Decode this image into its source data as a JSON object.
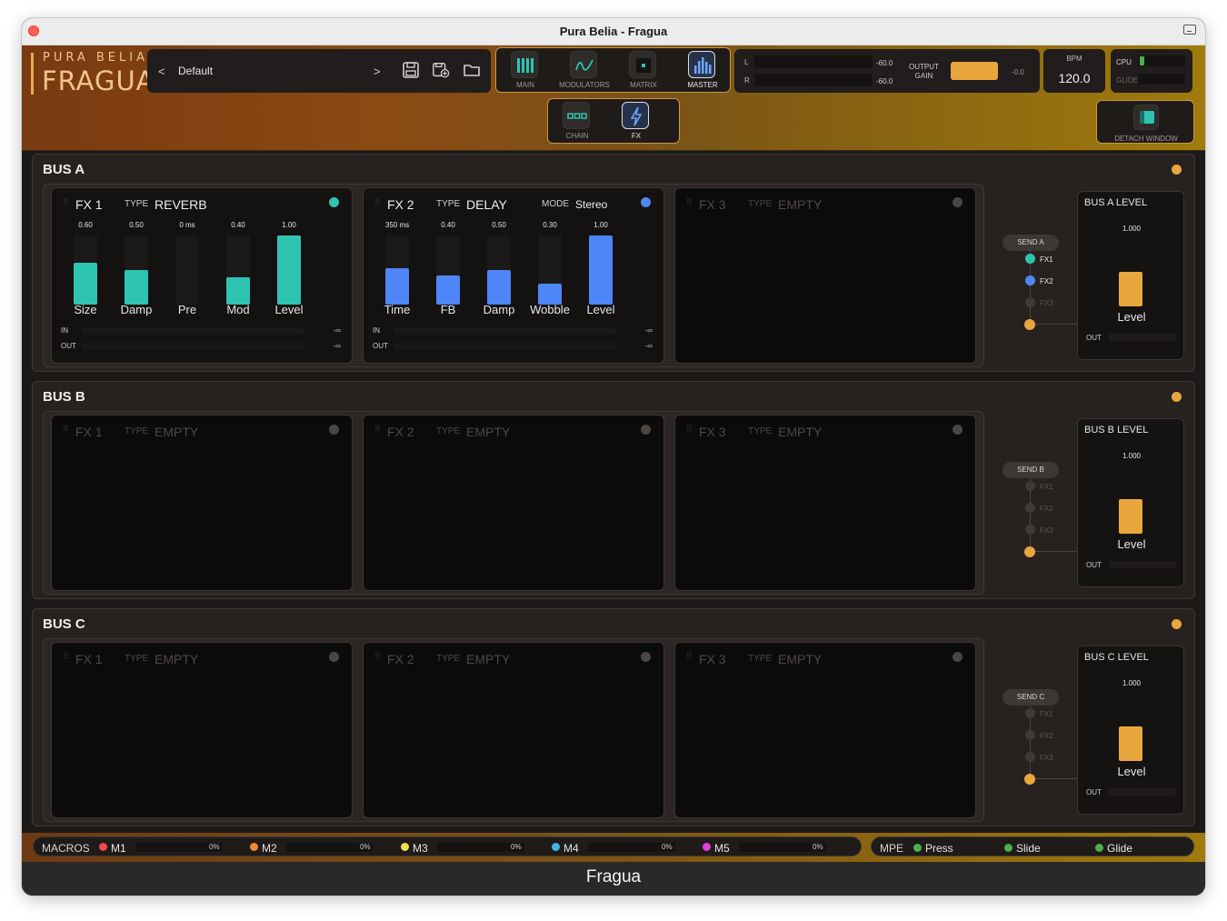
{
  "window": {
    "title": "Pura Belia - Fragua"
  },
  "brand": {
    "top": "PURA BELIA",
    "main": "FRAGUA"
  },
  "preset": {
    "prev": "<",
    "name": "Default",
    "next": ">"
  },
  "tabs": {
    "top": [
      {
        "label": "MAIN",
        "icon": "bars-icon"
      },
      {
        "label": "MODULATORS",
        "icon": "wave-icon"
      },
      {
        "label": "MATRIX",
        "icon": "matrix-icon"
      },
      {
        "label": "MASTER",
        "icon": "equalizer-icon",
        "active": true
      }
    ],
    "sub": [
      {
        "label": "CHAIN",
        "icon": "chain-icon"
      },
      {
        "label": "FX",
        "icon": "bolt-icon",
        "active": true
      }
    ]
  },
  "meters": {
    "l_label": "L",
    "r_label": "R",
    "l_value": "-60.0",
    "r_value": "-60.0",
    "gain_label_1": "OUTPUT",
    "gain_label_2": "GAIN",
    "gain_value": "-0.0"
  },
  "bpm": {
    "label": "BPM",
    "value": "120.0"
  },
  "cpu": {
    "cpu_label": "CPU",
    "glide_label": "GLIDE",
    "cpu_level": 0.1
  },
  "detach": {
    "label": "DETACH WINDOW"
  },
  "buses": [
    {
      "title": "BUS A",
      "send": "SEND A",
      "level_title": "BUS A LEVEL",
      "level_value": "1.000",
      "level_label": "Level",
      "out_label": "OUT",
      "routes": [
        "FX1",
        "FX2",
        "FX3"
      ],
      "slots": [
        {
          "name": "FX 1",
          "type_label": "TYPE",
          "type": "REVERB",
          "color": "#2fc4b2",
          "params": [
            {
              "label": "Size",
              "value": "0.60",
              "level": 0.6
            },
            {
              "label": "Damp",
              "value": "0.50",
              "level": 0.5
            },
            {
              "label": "Pre",
              "value": "0 ms",
              "level": 0
            },
            {
              "label": "Mod",
              "value": "0.40",
              "level": 0.4
            },
            {
              "label": "Level",
              "value": "1.00",
              "level": 1.0
            }
          ],
          "in_label": "IN",
          "out_label": "OUT",
          "in_value": "-∞",
          "out_value": "-∞"
        },
        {
          "name": "FX 2",
          "type_label": "TYPE",
          "type": "DELAY",
          "mode_label": "MODE",
          "mode": "Stereo",
          "color": "#4f86f7",
          "params": [
            {
              "label": "Time",
              "value": "350 ms",
              "level": 0.52
            },
            {
              "label": "FB",
              "value": "0.40",
              "level": 0.42
            },
            {
              "label": "Damp",
              "value": "0.50",
              "level": 0.5
            },
            {
              "label": "Wobble",
              "value": "0.30",
              "level": 0.3
            },
            {
              "label": "Level",
              "value": "1.00",
              "level": 1.0
            }
          ],
          "in_label": "IN",
          "out_label": "OUT",
          "in_value": "-∞",
          "out_value": "-∞"
        },
        {
          "name": "FX 3",
          "type_label": "TYPE",
          "type": "EMPTY"
        }
      ]
    },
    {
      "title": "BUS B",
      "send": "SEND B",
      "level_title": "BUS B LEVEL",
      "level_value": "1.000",
      "level_label": "Level",
      "out_label": "OUT",
      "routes": [
        "FX1",
        "FX2",
        "FX3"
      ],
      "slots": [
        {
          "name": "FX 1",
          "type_label": "TYPE",
          "type": "EMPTY"
        },
        {
          "name": "FX 2",
          "type_label": "TYPE",
          "type": "EMPTY"
        },
        {
          "name": "FX 3",
          "type_label": "TYPE",
          "type": "EMPTY"
        }
      ]
    },
    {
      "title": "BUS C",
      "send": "SEND C",
      "level_title": "BUS C LEVEL",
      "level_value": "1.000",
      "level_label": "Level",
      "out_label": "OUT",
      "routes": [
        "FX1",
        "FX2",
        "FX3"
      ],
      "slots": [
        {
          "name": "FX 1",
          "type_label": "TYPE",
          "type": "EMPTY"
        },
        {
          "name": "FX 2",
          "type_label": "TYPE",
          "type": "EMPTY"
        },
        {
          "name": "FX 3",
          "type_label": "TYPE",
          "type": "EMPTY"
        }
      ]
    }
  ],
  "macros": {
    "title": "MACROS",
    "items": [
      {
        "name": "M1",
        "value": "0%",
        "color": "#f0484a"
      },
      {
        "name": "M2",
        "value": "0%",
        "color": "#f08a30"
      },
      {
        "name": "M3",
        "value": "0%",
        "color": "#f2e14a"
      },
      {
        "name": "M4",
        "value": "0%",
        "color": "#3fb6e6"
      },
      {
        "name": "M5",
        "value": "0%",
        "color": "#e040e0"
      }
    ]
  },
  "mpe": {
    "title": "MPE",
    "items": [
      "Press",
      "Slide",
      "Glide"
    ]
  },
  "status": {
    "title": "Fragua"
  }
}
